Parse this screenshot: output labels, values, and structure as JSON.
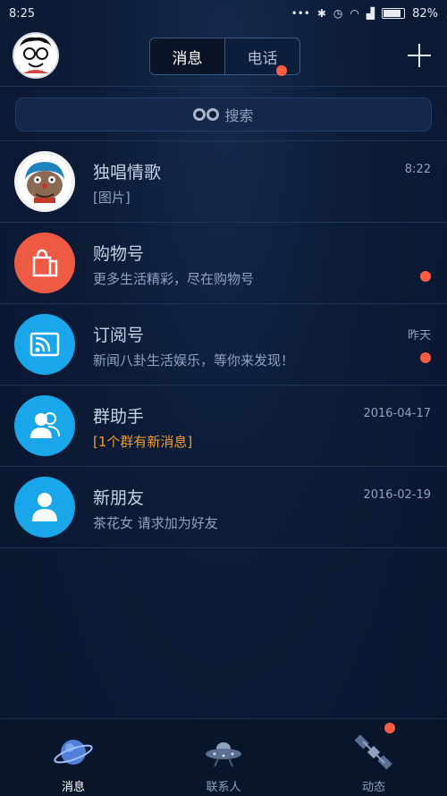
{
  "status_bar": {
    "time": "8:25",
    "dots": "•••",
    "battery": "82%"
  },
  "header": {
    "tabs": [
      {
        "label": "消息",
        "active": true
      },
      {
        "label": "电话",
        "active": false
      }
    ]
  },
  "search": {
    "label": "搜索"
  },
  "messages": [
    {
      "name": "独唱情歌",
      "preview": "[图片]",
      "time": "8:22",
      "unread": false,
      "avatar_color": "#f2f2f2"
    },
    {
      "name": "购物号",
      "preview": "更多生活精彩，尽在购物号",
      "time": "",
      "unread": true,
      "avatar_color": "#ef5a45"
    },
    {
      "name": "订阅号",
      "preview": "新闻八卦生活娱乐，等你来发现！",
      "time": "昨天",
      "unread": true,
      "avatar_color": "#19a6ea"
    },
    {
      "name": "群助手",
      "preview": "[1个群有新消息]",
      "time": "2016-04-17",
      "unread": false,
      "avatar_color": "#19a6ea",
      "preview_color": "#f19a2e"
    },
    {
      "name": "新朋友",
      "preview": "茶花女 请求加为好友",
      "time": "2016-02-19",
      "unread": false,
      "avatar_color": "#19a6ea"
    }
  ],
  "tabbar": {
    "items": [
      {
        "label": "消息",
        "active": true
      },
      {
        "label": "联系人",
        "active": false
      },
      {
        "label": "动态",
        "active": false
      }
    ]
  },
  "colors": {
    "background": "#0b1a33",
    "accent_red": "#ff5d43",
    "accent_blue": "#19a6ea",
    "accent_orange": "#f19a2e"
  }
}
